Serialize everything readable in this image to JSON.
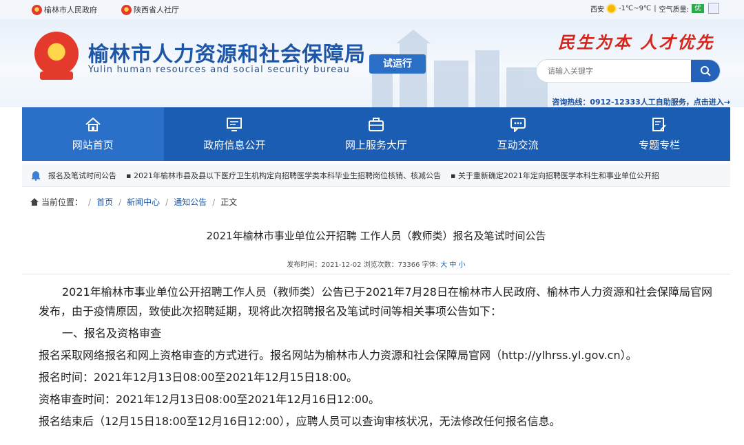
{
  "topbar": {
    "links": [
      "榆林市人民政府",
      "陕西省人社厅"
    ],
    "city": "西安",
    "temp": "-1℃~9℃",
    "aq_label": "空气质量:",
    "aq_value": "优",
    "colors": {
      "aq": "#2aa84a"
    }
  },
  "header": {
    "title": "榆林市人力资源和社会保障局",
    "subtitle": "Yulin human resources and social security bureau",
    "badge": "试运行",
    "slogan": "民生为本  人才优先",
    "search_placeholder": "请输入关键字",
    "hotline": "咨询热线：0912-12333人工自助服务，点击进入→",
    "colors": {
      "brand": "#1d56a6",
      "slogan": "#d8251b"
    }
  },
  "nav": {
    "items": [
      {
        "label": "网站首页",
        "icon": "home-icon"
      },
      {
        "label": "政府信息公开",
        "icon": "monitor-icon"
      },
      {
        "label": "网上服务大厅",
        "icon": "briefcase-icon"
      },
      {
        "label": "互动交流",
        "icon": "chat-icon"
      },
      {
        "label": "专题专栏",
        "icon": "edit-doc-icon"
      }
    ],
    "color": "#1a5db2"
  },
  "ticker": {
    "items": [
      "报名及笔试时间公告",
      "▪ 2021年榆林市县及县以下医疗卫生机构定向招聘医学类本科毕业生招聘岗位核销、核减公告",
      "▪ 关于重新确定2021年定向招聘医学本科生和事业单位公开招"
    ]
  },
  "breadcrumb": {
    "label": "当前位置：",
    "items": [
      "首页",
      "新闻中心",
      "通知公告",
      "正文"
    ]
  },
  "article": {
    "title": "2021年榆林市事业单位公开招聘 工作人员（教师类）报名及笔试时间公告",
    "meta_prefix": "发布时间：2021-12-02 浏览次数：73366 字体:",
    "font_sizes": [
      "大",
      "中",
      "小"
    ],
    "paragraphs": [
      "2021年榆林市事业单位公开招聘工作人员（教师类）公告已于2021年7月28日在榆林市人民政府、榆林市人力资源和社会保障局官网发布，由于疫情原因，致使此次招聘延期，现将此次招聘报名及笔试时间等相关事项公告如下：",
      "一、报名及资格审查",
      "报名采取网络报名和网上资格审查的方式进行。报名网站为榆林市人力资源和社会保障局官网（http://ylhrss.yl.gov.cn）。",
      "报名时间：2021年12月13日08:00至2021年12月15日18:00。",
      "资格审查时间：2021年12月13日08:00至2021年12月16日12:00。",
      "报名结束后（12月15日18:00至12月16日12:00），应聘人员可以查询审核状况，无法修改任何报名信息。"
    ]
  }
}
